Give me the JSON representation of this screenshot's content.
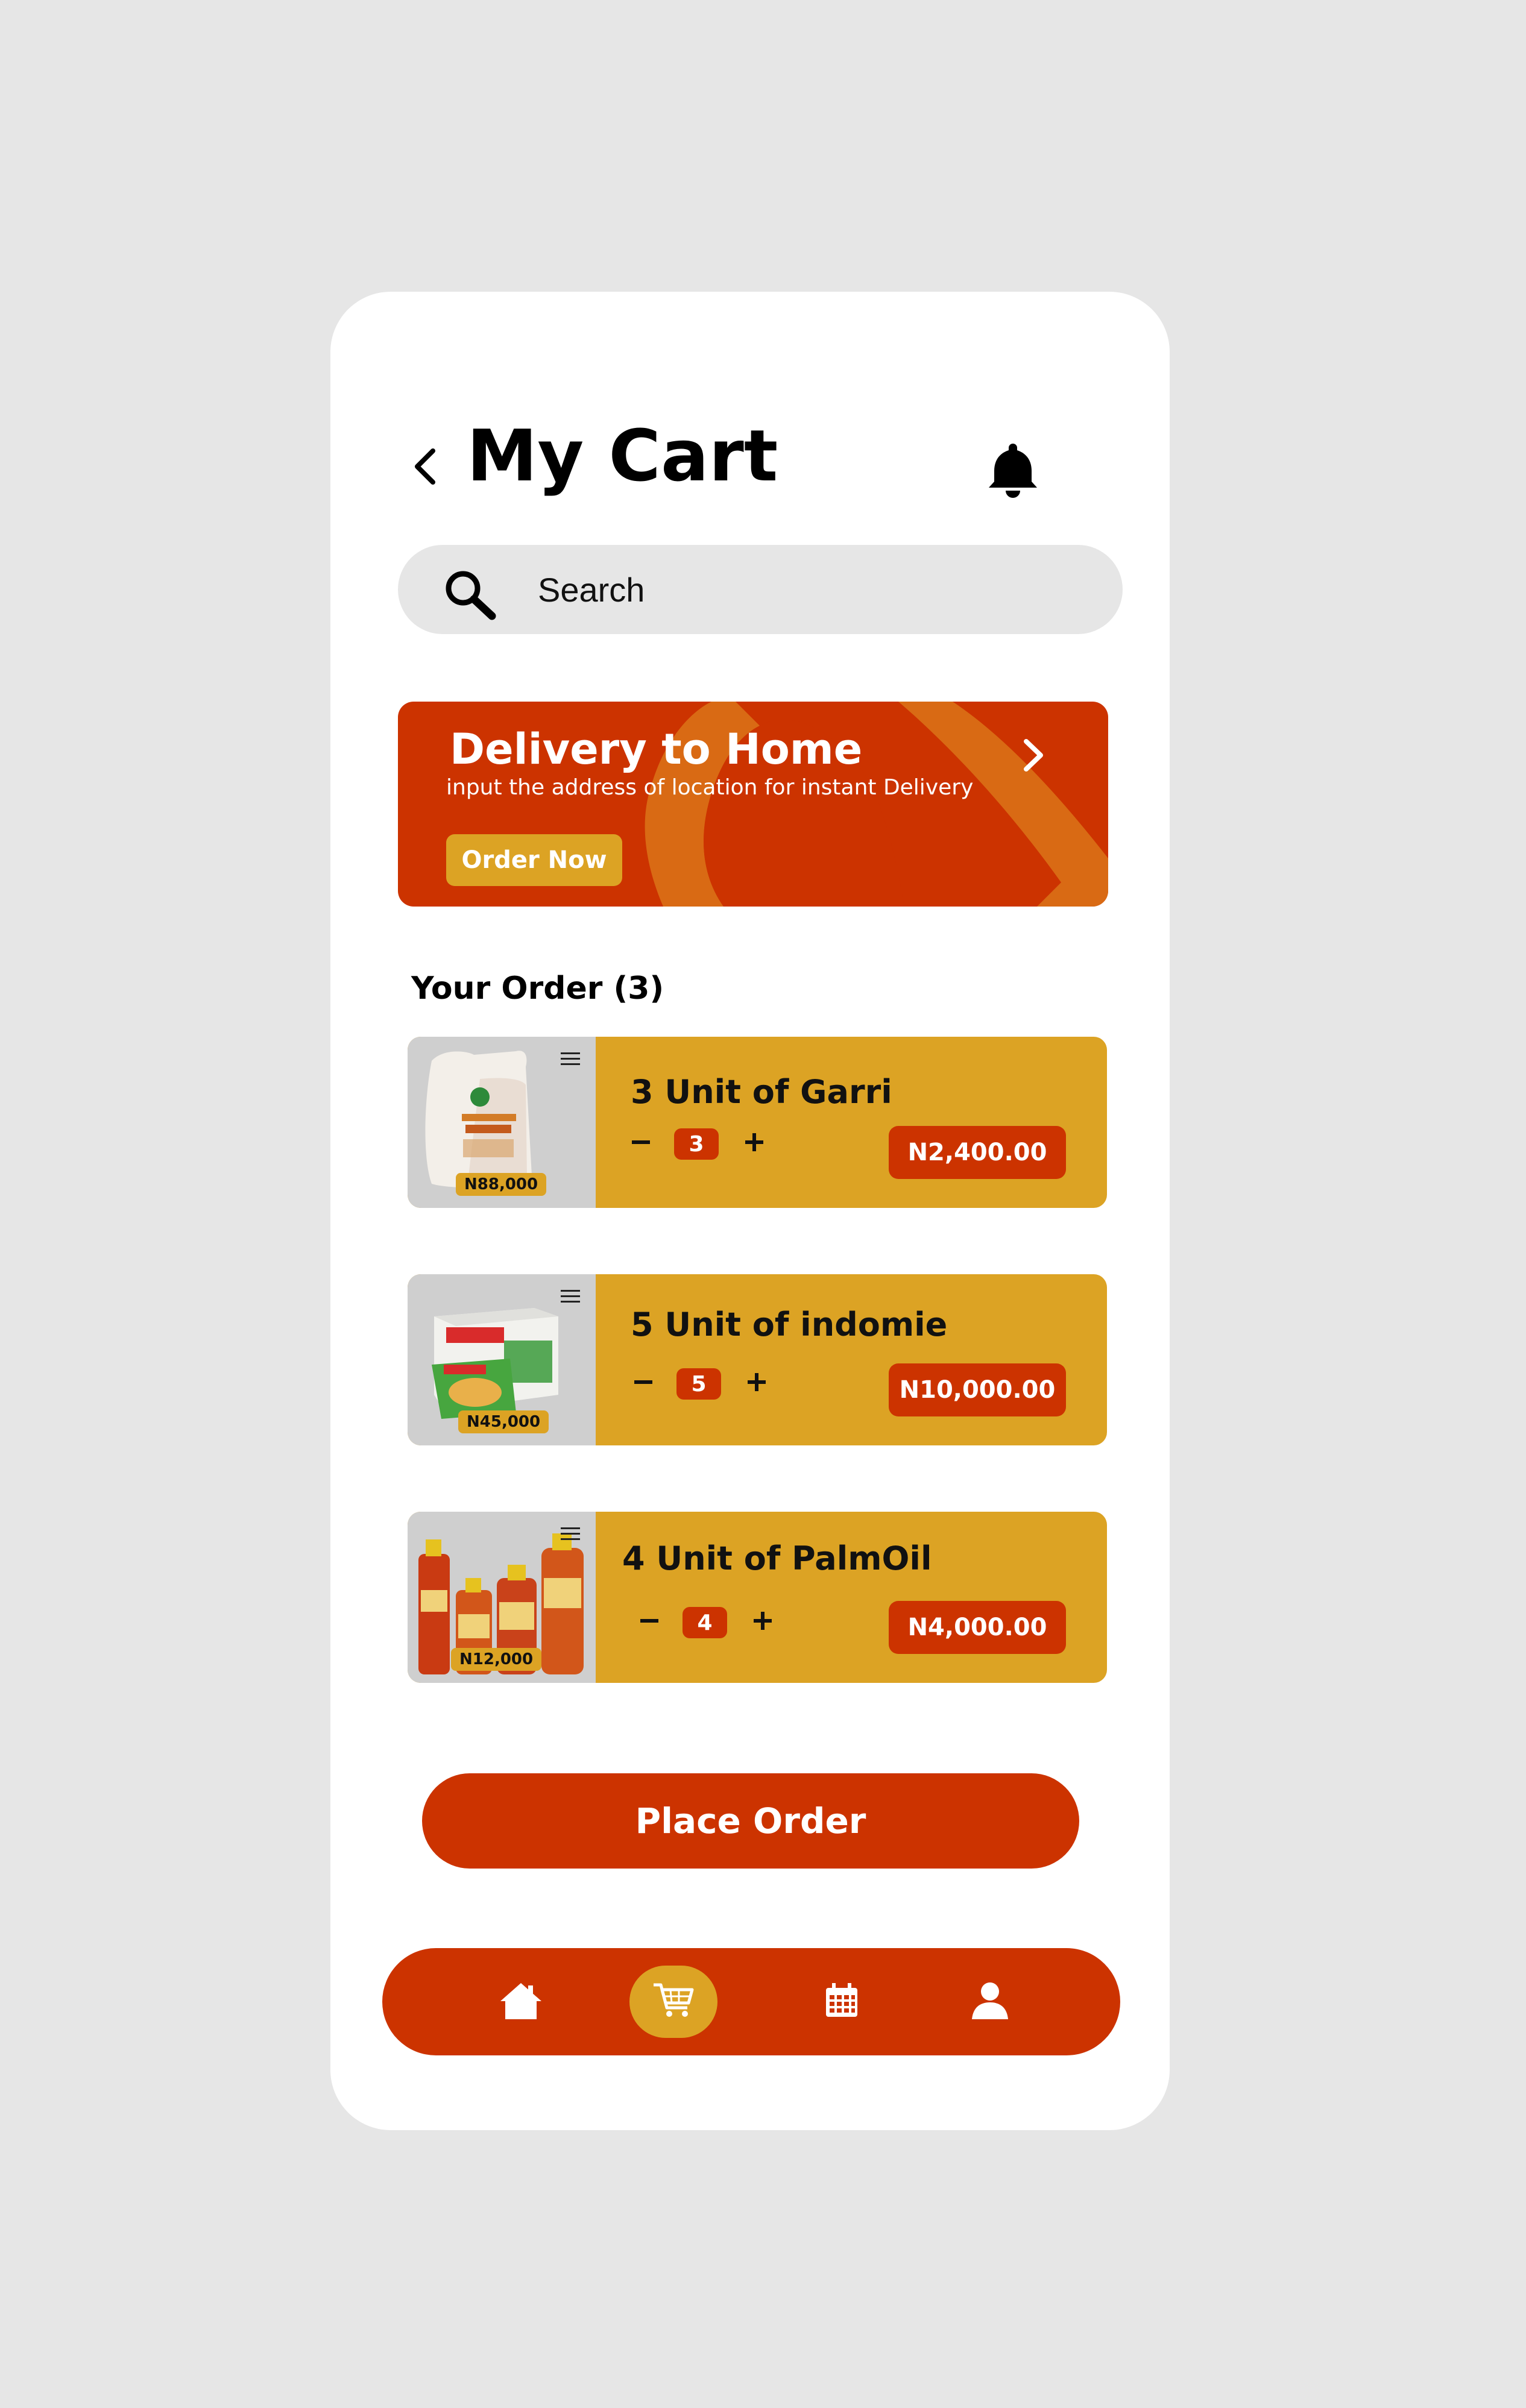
{
  "header": {
    "title": "My Cart",
    "back_icon": "chevron-left-icon",
    "notification_icon": "bell-icon"
  },
  "search": {
    "placeholder": "Search",
    "value": ""
  },
  "banner": {
    "title": "Delivery to Home",
    "subtitle": "input the address of location for instant Delivery",
    "button_label": "Order Now"
  },
  "orders": {
    "heading": "Your Order (3)",
    "items": [
      {
        "name": "3 Unit of Garri",
        "quantity": "3",
        "unit_price": "N88,000",
        "total": "N2,400.00",
        "image": "garri-sack"
      },
      {
        "name": "5 Unit of indomie",
        "quantity": "5",
        "unit_price": "N45,000",
        "total": "N10,000.00",
        "image": "indomie-carton"
      },
      {
        "name": "4 Unit of PalmOil",
        "quantity": "4",
        "unit_price": "N12,000",
        "total": "N4,000.00",
        "image": "palm-oil-bottles"
      }
    ]
  },
  "place_order": {
    "label": "Place Order"
  },
  "bottom_nav": {
    "items": [
      {
        "icon": "home-icon",
        "active": false
      },
      {
        "icon": "cart-icon",
        "active": true
      },
      {
        "icon": "calendar-icon",
        "active": false
      },
      {
        "icon": "profile-icon",
        "active": false
      }
    ]
  },
  "colors": {
    "primary": "#cc3300",
    "accent": "#dca324",
    "background": "#e6e6e6",
    "card": "#ffffff"
  }
}
